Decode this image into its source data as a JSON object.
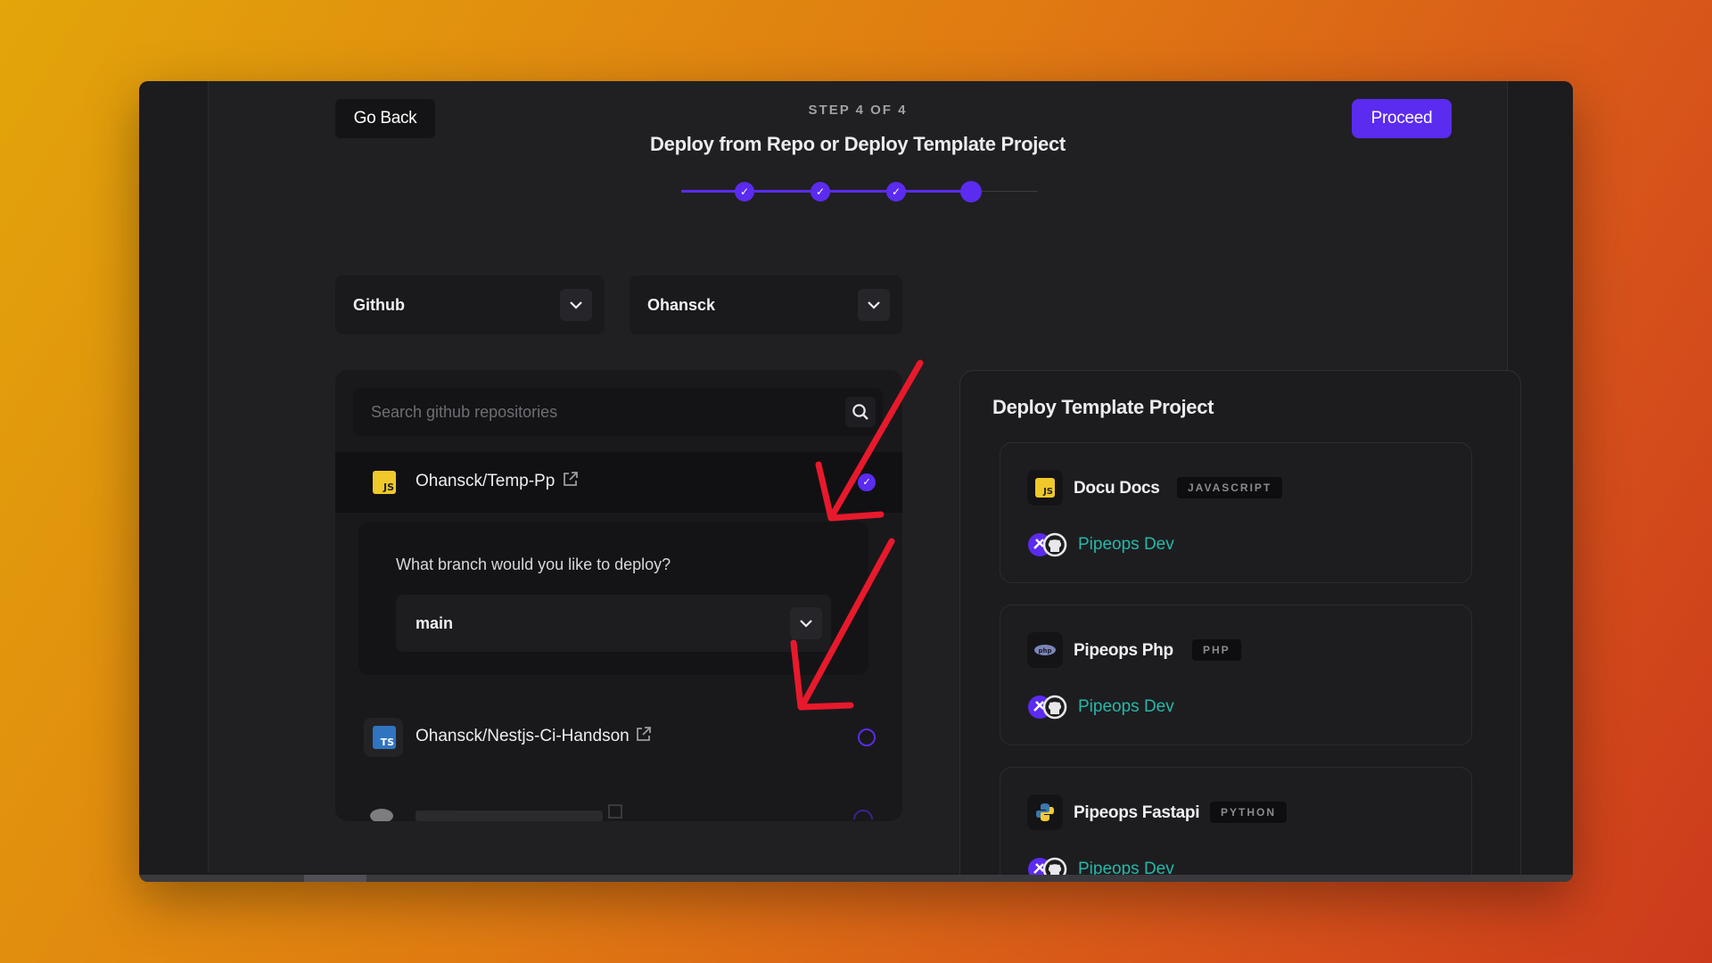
{
  "header": {
    "back_label": "Go Back",
    "proceed_label": "Proceed",
    "step_label": "STEP 4 OF 4",
    "title": "Deploy from Repo or Deploy Template Project",
    "steps_completed": 3,
    "steps_total": 4
  },
  "selects": {
    "provider": "Github",
    "account": "Ohansck"
  },
  "search": {
    "placeholder": "Search github repositories"
  },
  "repos": [
    {
      "name": "Ohansck/Temp-Pp",
      "lang": "JS",
      "selected": true
    },
    {
      "name": "Ohansck/Nestjs-Ci-Handson",
      "lang": "TS",
      "selected": false
    }
  ],
  "branch": {
    "question": "What branch would you like to deploy?",
    "value": "main"
  },
  "templates": {
    "title": "Deploy Template Project",
    "items": [
      {
        "name": "Docu Docs",
        "tag": "JAVASCRIPT",
        "author": "Pipeops Dev",
        "icon": "js-icon"
      },
      {
        "name": "Pipeops Php",
        "tag": "PHP",
        "author": "Pipeops Dev",
        "icon": "php-icon"
      },
      {
        "name": "Pipeops Fastapi",
        "tag": "PYTHON",
        "author": "Pipeops Dev",
        "icon": "python-icon"
      }
    ]
  },
  "colors": {
    "accent": "#5b2bf0",
    "author_link": "#26b8a8",
    "annotation_arrow": "#e8192c"
  }
}
